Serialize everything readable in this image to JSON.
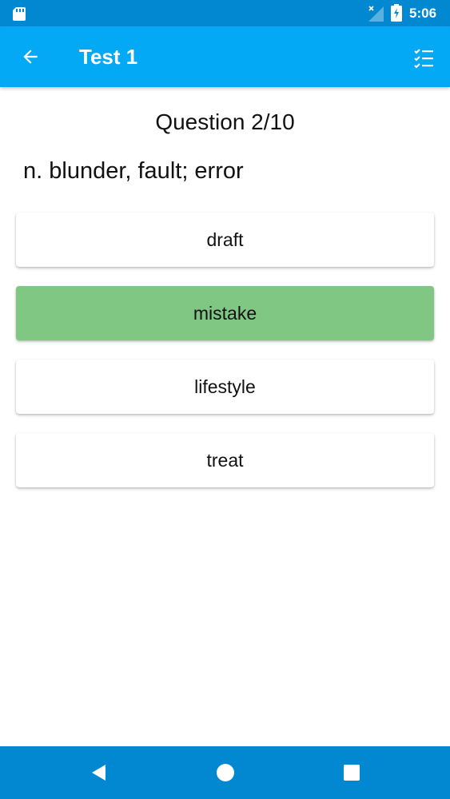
{
  "status_bar": {
    "time": "5:06",
    "icons": [
      "sd-card-icon",
      "signal-off-icon",
      "battery-charging-icon"
    ]
  },
  "app_bar": {
    "title": "Test 1",
    "back_icon": "arrow-left-icon",
    "action_icon": "checklist-icon",
    "color": "#03a9f4"
  },
  "quiz": {
    "counter": "Question 2/10",
    "prompt": "n. blunder, fault; error",
    "answers": [
      {
        "label": "draft",
        "state": "normal"
      },
      {
        "label": "mistake",
        "state": "correct"
      },
      {
        "label": "lifestyle",
        "state": "normal"
      },
      {
        "label": "treat",
        "state": "normal"
      }
    ],
    "correct_color": "#81c784"
  },
  "nav_bar": {
    "buttons": [
      "back-triangle-icon",
      "home-circle-icon",
      "recents-square-icon"
    ],
    "color": "#0288d1"
  }
}
